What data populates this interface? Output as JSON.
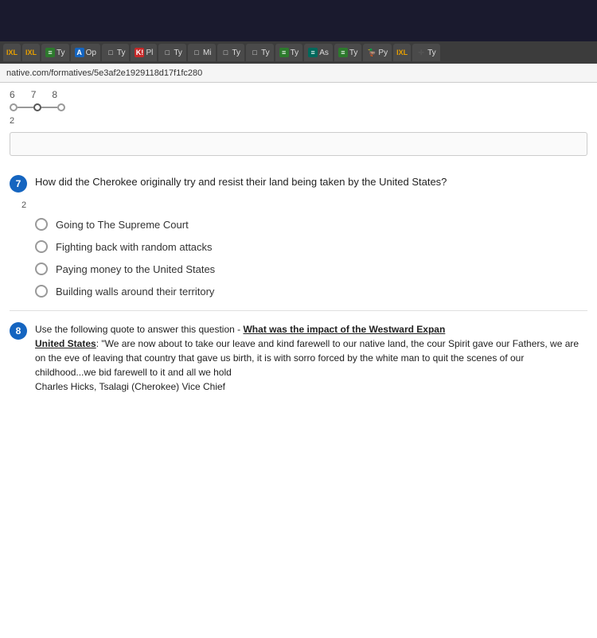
{
  "browser": {
    "address": "native.com/formatives/5e3af2e1929118d17f1fc280",
    "tabs": [
      {
        "label": "IXL",
        "icon": "IXL",
        "type": "ixl"
      },
      {
        "label": "Ty",
        "icon": "≡",
        "type": "green"
      },
      {
        "label": "Op",
        "icon": "A",
        "type": "blue"
      },
      {
        "label": "Ty",
        "icon": "□",
        "type": "none"
      },
      {
        "label": "Pl",
        "icon": "K!",
        "type": "orange"
      },
      {
        "label": "Ty",
        "icon": "□",
        "type": "none"
      },
      {
        "label": "Mi",
        "icon": "□",
        "type": "none"
      },
      {
        "label": "Ty",
        "icon": "□",
        "type": "none"
      },
      {
        "label": "Ty",
        "icon": "□",
        "type": "none"
      },
      {
        "label": "Ty",
        "icon": "≡",
        "type": "green"
      },
      {
        "label": "As",
        "icon": "≡",
        "type": "teal"
      },
      {
        "label": "Ty",
        "icon": "≡",
        "type": "green"
      },
      {
        "label": "Py",
        "icon": "🦆",
        "type": "none"
      },
      {
        "label": "IXL",
        "icon": "IXL",
        "type": "ixl"
      },
      {
        "label": "Ty",
        "icon": "+",
        "type": "cross"
      }
    ]
  },
  "progress": {
    "numbers": [
      "6",
      "7",
      "8"
    ],
    "dots": 3
  },
  "question7": {
    "number": "7",
    "text": "How did the Cherokee originally try and resist their land being taken by the United States?",
    "options": [
      "Going to The Supreme Court",
      "Fighting back with random attacks",
      "Paying money to the United States",
      "Building walls around their territory"
    ]
  },
  "question8": {
    "number": "8",
    "intro": "Use the following quote to answer this question - ",
    "title": "What was the impact of the Westward Expan",
    "title_suffix": "United States",
    "quote": "\"We are now about to take our leave and kind farewell to our native land, the cour Spirit gave our Fathers, we are on the eve of leaving that country that gave us birth, it is with sorro forced by the white man to quit the scenes of our childhood...we bid farewell to it and all we hold",
    "attribution": "Charles Hicks, Tsalagi (Cherokee) Vice Chief"
  },
  "score_labels": {
    "score1": "2",
    "score2": "2"
  }
}
